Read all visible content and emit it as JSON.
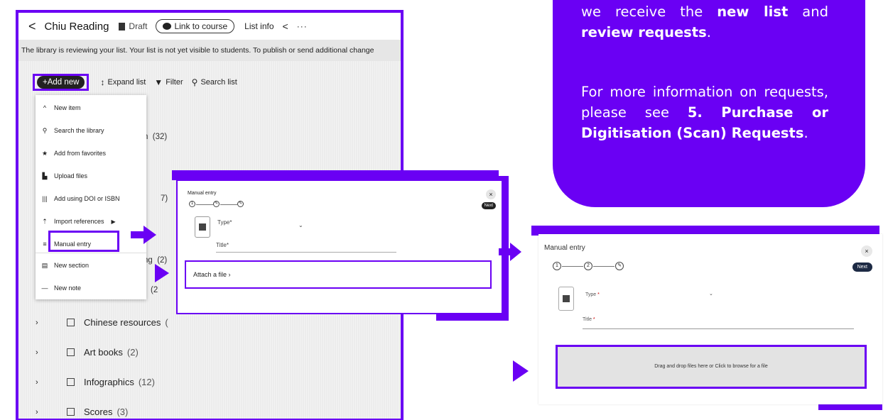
{
  "header": {
    "back": "<",
    "title": "Chiu Reading",
    "draft_label": "Draft",
    "link_label": "Link to course",
    "info_label": "List info",
    "share_icon": "share-icon",
    "more_label": "···"
  },
  "banner_text": "The library is reviewing your list. Your list is not yet visible to students. To publish or send additional change",
  "toolbar": {
    "add_label": "+Add new",
    "expand_label": "Expand list",
    "filter_label": "Filter",
    "search_label": "Search list"
  },
  "menu": {
    "new_item": "New item",
    "search_library": "Search the library",
    "add_favorites": "Add from favorites",
    "upload_files": "Upload files",
    "doi_isbn": "Add using DOI or ISBN",
    "import_refs": "Import references",
    "manual_entry": "Manual entry",
    "new_section": "New section",
    "new_note": "New note"
  },
  "list_fragments": {
    "f1": "n",
    "f1_count": "(32)",
    "f2": "7)",
    "f3": "ng",
    "f3_count": "(2)",
    "f4": "(2"
  },
  "sections": [
    {
      "label": "Chinese resources",
      "count": "("
    },
    {
      "label": "Art books",
      "count": "(2)"
    },
    {
      "label": "Infographics",
      "count": "(12)"
    },
    {
      "label": "Scores",
      "count": "(3)"
    }
  ],
  "dialog_small": {
    "title": "Manual entry",
    "close": "×",
    "next": "Next",
    "step1": "1",
    "type_label": "Type*",
    "title_label": "Title*",
    "attach_label": "Attach a file  ›"
  },
  "dialog_large": {
    "title": "Manual entry",
    "close": "×",
    "next": "Next",
    "step1": "1",
    "step2": "2",
    "type_label": "Type",
    "title_label": "Title",
    "required_mark": "*",
    "drop_label": "Drag and drop files here or Click to browse for a file"
  },
  "bubble": {
    "p1_pre": "we receive the ",
    "p1_bold1": "new list",
    "p1_mid": " and ",
    "p1_bold2": "review requests",
    "p1_end": ".",
    "p2_pre": "For more information on requests, please see ",
    "p2_bold": "5. Purchase or Digitisation (Scan) Requests",
    "p2_end": "."
  },
  "colors": {
    "accent": "#6a00f4"
  }
}
